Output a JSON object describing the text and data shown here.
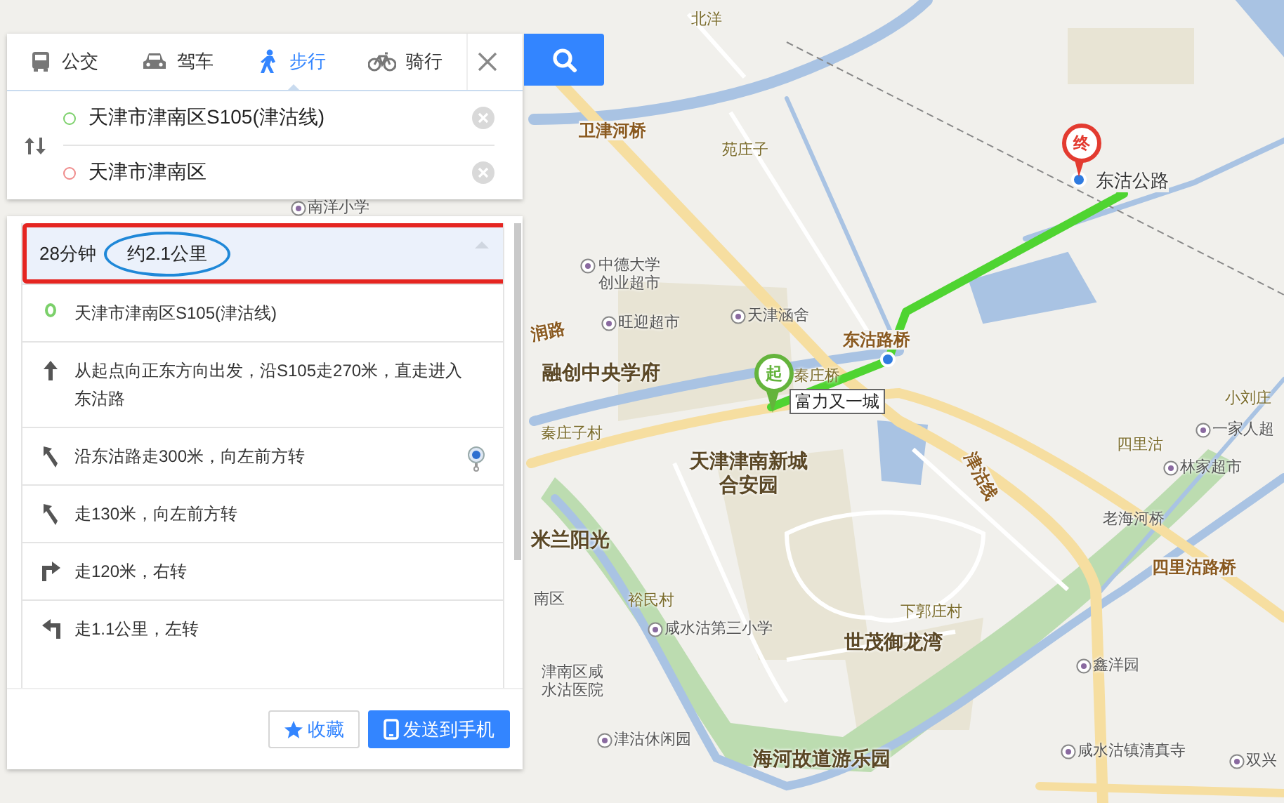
{
  "tabs": [
    {
      "label": "公交",
      "kind": "bus",
      "selected": false
    },
    {
      "label": "驾车",
      "kind": "car",
      "selected": false
    },
    {
      "label": "步行",
      "kind": "walk",
      "selected": true
    },
    {
      "label": "骑行",
      "kind": "bike",
      "selected": false
    }
  ],
  "start": {
    "value": "天津市津南区S105(津沽线)"
  },
  "end": {
    "value": "天津市津南区"
  },
  "summary": {
    "time": "28分钟",
    "distance": "约2.1公里",
    "highlighted": true,
    "distance_circled": true
  },
  "steps": [
    {
      "kind": "start",
      "text": "天津市津南区S105(津沽线)",
      "locate": false
    },
    {
      "kind": "straight",
      "text": "从起点向正东方向出发，沿S105走270米，直走进入东沽路",
      "locate": false
    },
    {
      "kind": "left-front",
      "text": "沿东沽路走300米，向左前方转",
      "locate": true
    },
    {
      "kind": "left-front",
      "text": "走130米，向左前方转",
      "locate": false
    },
    {
      "kind": "right",
      "text": "走120米，右转",
      "locate": false
    },
    {
      "kind": "left",
      "text": "走1.1公里，左转",
      "locate": false
    }
  ],
  "buttons": [
    {
      "kind": "favorite",
      "label": "收藏"
    },
    {
      "kind": "phone",
      "label": "发送到手机"
    }
  ],
  "map": {
    "start_marker": "起",
    "end_marker": "终",
    "place_tag": "富力又一城",
    "labels": [
      {
        "text": "北洋",
        "kind": "place"
      },
      {
        "text": "卫津河桥",
        "kind": "road"
      },
      {
        "text": "苑庄子",
        "kind": "place"
      },
      {
        "text": "中德大学创业超市",
        "kind": "poi"
      },
      {
        "text": "旺迎超市",
        "kind": "poi"
      },
      {
        "text": "天津涵舍",
        "kind": "poi"
      },
      {
        "text": "润路",
        "kind": "road"
      },
      {
        "text": "融创中央学府",
        "kind": "area"
      },
      {
        "text": "东沽路桥",
        "kind": "road"
      },
      {
        "text": "秦庄桥",
        "kind": "place"
      },
      {
        "text": "东沽公路",
        "kind": "street"
      },
      {
        "text": "小刘庄",
        "kind": "place"
      },
      {
        "text": "一家人超",
        "kind": "poi"
      },
      {
        "text": "四里沽",
        "kind": "place"
      },
      {
        "text": "林家超市",
        "kind": "poi"
      },
      {
        "text": "老海河桥",
        "kind": "label"
      },
      {
        "text": "四里沽路桥",
        "kind": "road"
      },
      {
        "text": "津沽线",
        "kind": "road"
      },
      {
        "text": "秦庄子村",
        "kind": "place"
      },
      {
        "text": "天津津南新城合安园",
        "kind": "area"
      },
      {
        "text": "米兰阳光",
        "kind": "area"
      },
      {
        "text": "南区",
        "kind": "label"
      },
      {
        "text": "裕民村",
        "kind": "place"
      },
      {
        "text": "咸水沽第三小学",
        "kind": "poi"
      },
      {
        "text": "津南区咸水沽医院",
        "kind": "label"
      },
      {
        "text": "下郭庄村",
        "kind": "place"
      },
      {
        "text": "世茂御龙湾",
        "kind": "area"
      },
      {
        "text": "鑫洋园",
        "kind": "poi"
      },
      {
        "text": "津沽休闲园",
        "kind": "poi"
      },
      {
        "text": "海河故道游乐园",
        "kind": "area"
      },
      {
        "text": "咸水沽镇清真寺",
        "kind": "poi"
      },
      {
        "text": "双兴",
        "kind": "poi"
      },
      {
        "text": "南洋小学",
        "kind": "poi"
      }
    ]
  }
}
